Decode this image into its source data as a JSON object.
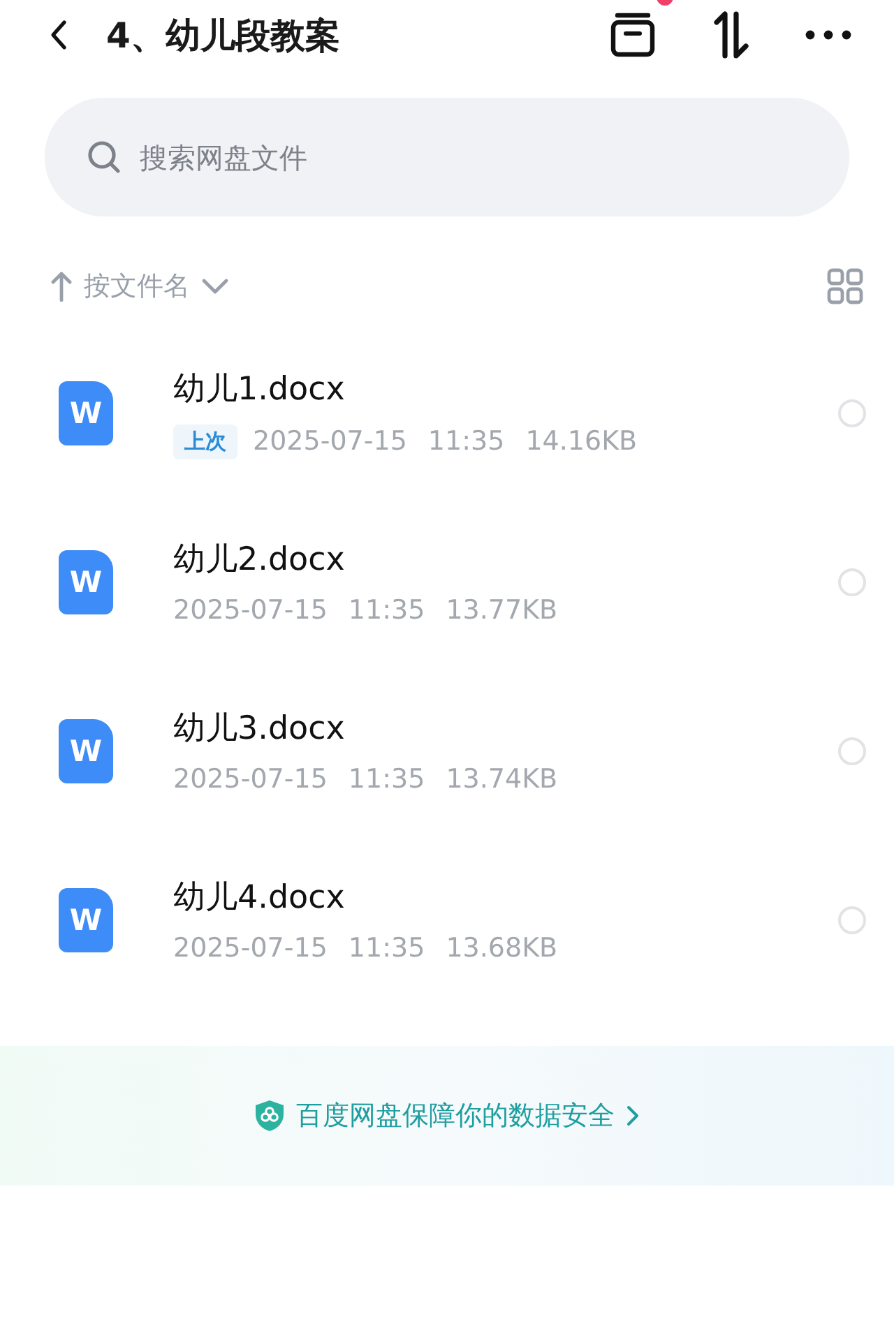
{
  "header": {
    "title": "4、幼儿段教案",
    "notification_dot": true
  },
  "search": {
    "placeholder": "搜索网盘文件"
  },
  "sort": {
    "label": "按文件名"
  },
  "files": [
    {
      "icon_letter": "W",
      "name": "幼儿1.docx",
      "tag": "上次",
      "date": "2025-07-15",
      "time": "11:35",
      "size": "14.16KB",
      "selected": false
    },
    {
      "icon_letter": "W",
      "name": "幼儿2.docx",
      "date": "2025-07-15",
      "time": "11:35",
      "size": "13.77KB",
      "selected": false
    },
    {
      "icon_letter": "W",
      "name": "幼儿3.docx",
      "date": "2025-07-15",
      "time": "11:35",
      "size": "13.74KB",
      "selected": false
    },
    {
      "icon_letter": "W",
      "name": "幼儿4.docx",
      "date": "2025-07-15",
      "time": "11:35",
      "size": "13.68KB",
      "selected": false
    }
  ],
  "footer": {
    "text": "百度网盘保障你的数据安全"
  }
}
